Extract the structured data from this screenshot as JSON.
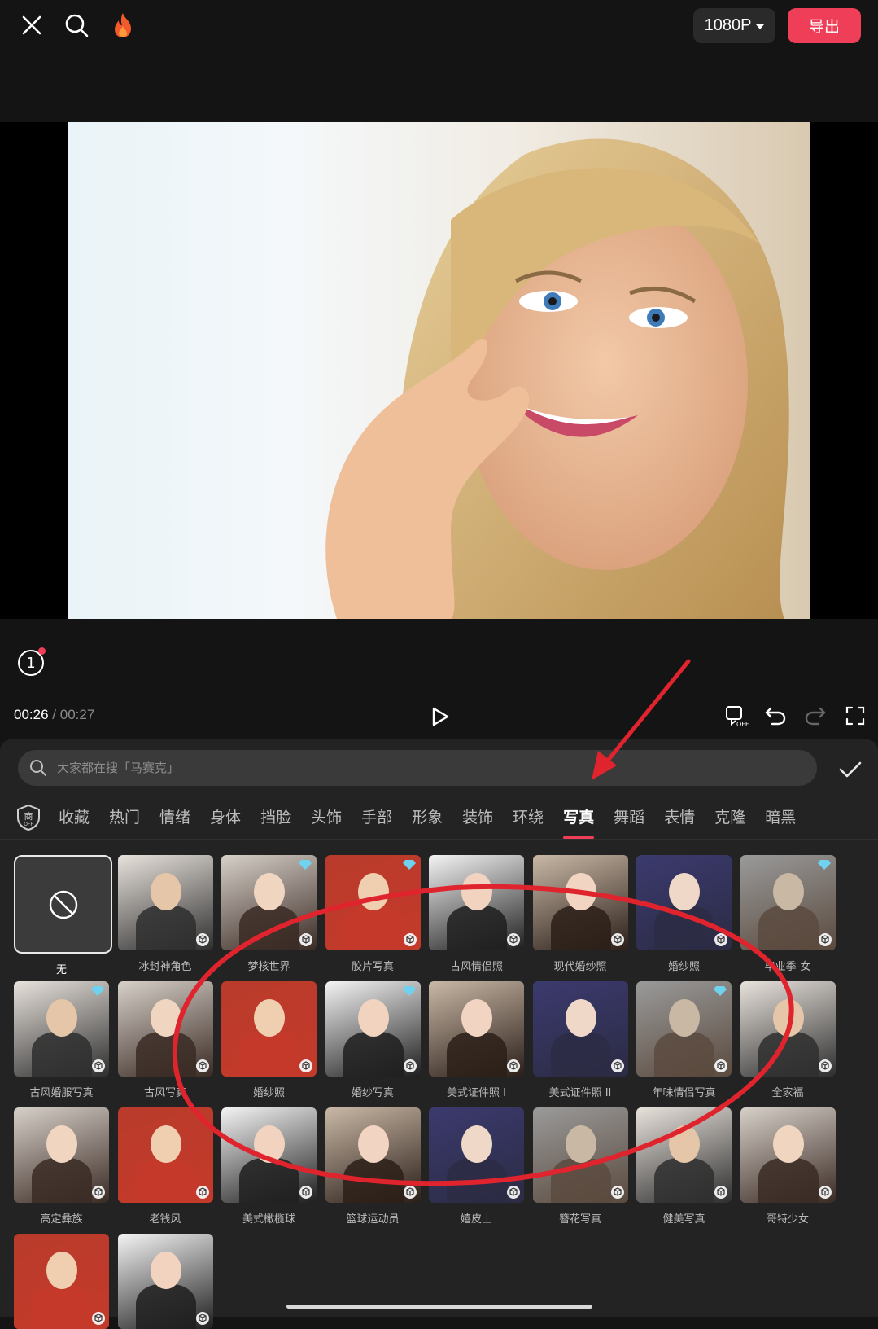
{
  "toolbar": {
    "close_icon": "close-icon",
    "search_icon": "search-icon",
    "flame_icon": "flame-icon",
    "resolution": "1080P",
    "export_label": "导出"
  },
  "player": {
    "layer_count": "1",
    "current_time": "00:26",
    "separator": "/",
    "total_time": "00:27"
  },
  "effects": {
    "search_placeholder": "大家都在搜「马赛克」",
    "commerce_badge": "商",
    "commerce_badge_sub": "OFF",
    "tabs": [
      "收藏",
      "热门",
      "情绪",
      "身体",
      "挡脸",
      "头饰",
      "手部",
      "形象",
      "装饰",
      "环绕",
      "写真",
      "舞蹈",
      "表情",
      "克隆",
      "暗黑"
    ],
    "active_tab": "写真",
    "items": [
      {
        "label": "无"
      },
      {
        "label": "冰封神角色"
      },
      {
        "label": "梦核世界",
        "vip": true
      },
      {
        "label": "胶片写真",
        "vip": true
      },
      {
        "label": "古风情侣照"
      },
      {
        "label": "现代婚纱照"
      },
      {
        "label": "婚纱照"
      },
      {
        "label": "毕业季-女",
        "vip": true
      },
      {
        "label": "古风婚服写真",
        "vip": true
      },
      {
        "label": "古风写真"
      },
      {
        "label": "婚纱照"
      },
      {
        "label": "婚纱写真",
        "vip": true
      },
      {
        "label": "美式证件照 I"
      },
      {
        "label": "美式证件照 II"
      },
      {
        "label": "年味情侣写真",
        "vip": true
      },
      {
        "label": "全家福"
      },
      {
        "label": "高定彝族"
      },
      {
        "label": "老钱风"
      },
      {
        "label": "美式橄榄球"
      },
      {
        "label": "篮球运动员"
      },
      {
        "label": "嬉皮士"
      },
      {
        "label": "簪花写真"
      },
      {
        "label": "健美写真"
      },
      {
        "label": "哥特少女"
      },
      {
        "label": ""
      },
      {
        "label": ""
      }
    ]
  },
  "colors": {
    "accent": "#ef3e58",
    "annotation": "#e0242e",
    "background": "#141414",
    "panel": "#232323"
  }
}
